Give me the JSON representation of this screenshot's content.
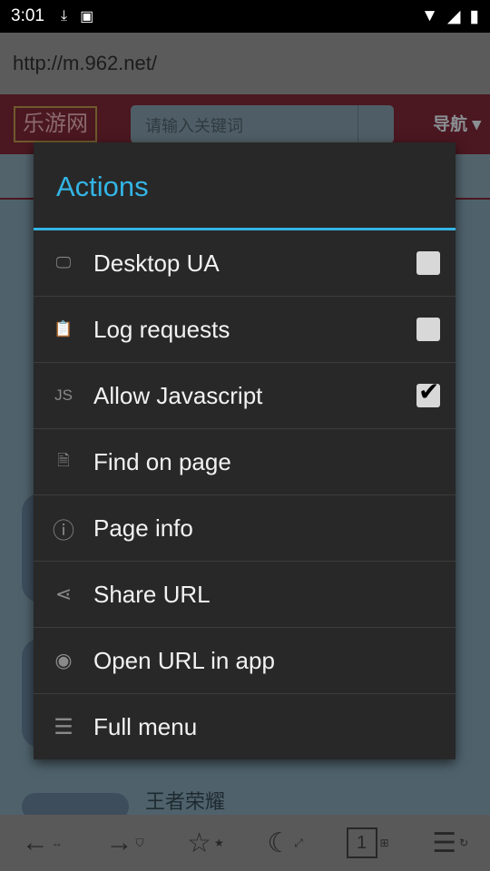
{
  "status": {
    "time": "3:01"
  },
  "browser": {
    "url": "http://m.962.net/"
  },
  "page": {
    "logo": "乐游网",
    "search_placeholder": "请输入关键词",
    "nav": "导航",
    "game_title": "王者荣耀"
  },
  "menu": {
    "title": "Actions",
    "accent": "#33b5e5",
    "items": [
      {
        "label": "Desktop UA",
        "icon": "monitor-icon",
        "checkbox": true,
        "checked": false
      },
      {
        "label": "Log requests",
        "icon": "clipboard-icon",
        "checkbox": true,
        "checked": false
      },
      {
        "label": "Allow Javascript",
        "icon": "js-icon",
        "icon_text": "JS",
        "checkbox": true,
        "checked": true
      },
      {
        "label": "Find on page",
        "icon": "find-page-icon"
      },
      {
        "label": "Page info",
        "icon": "info-icon"
      },
      {
        "label": "Share URL",
        "icon": "share-icon"
      },
      {
        "label": "Open URL in app",
        "icon": "eye-icon"
      },
      {
        "label": "Full menu",
        "icon": "menu-icon"
      }
    ]
  },
  "toolbar": {
    "tab_count": "1"
  }
}
